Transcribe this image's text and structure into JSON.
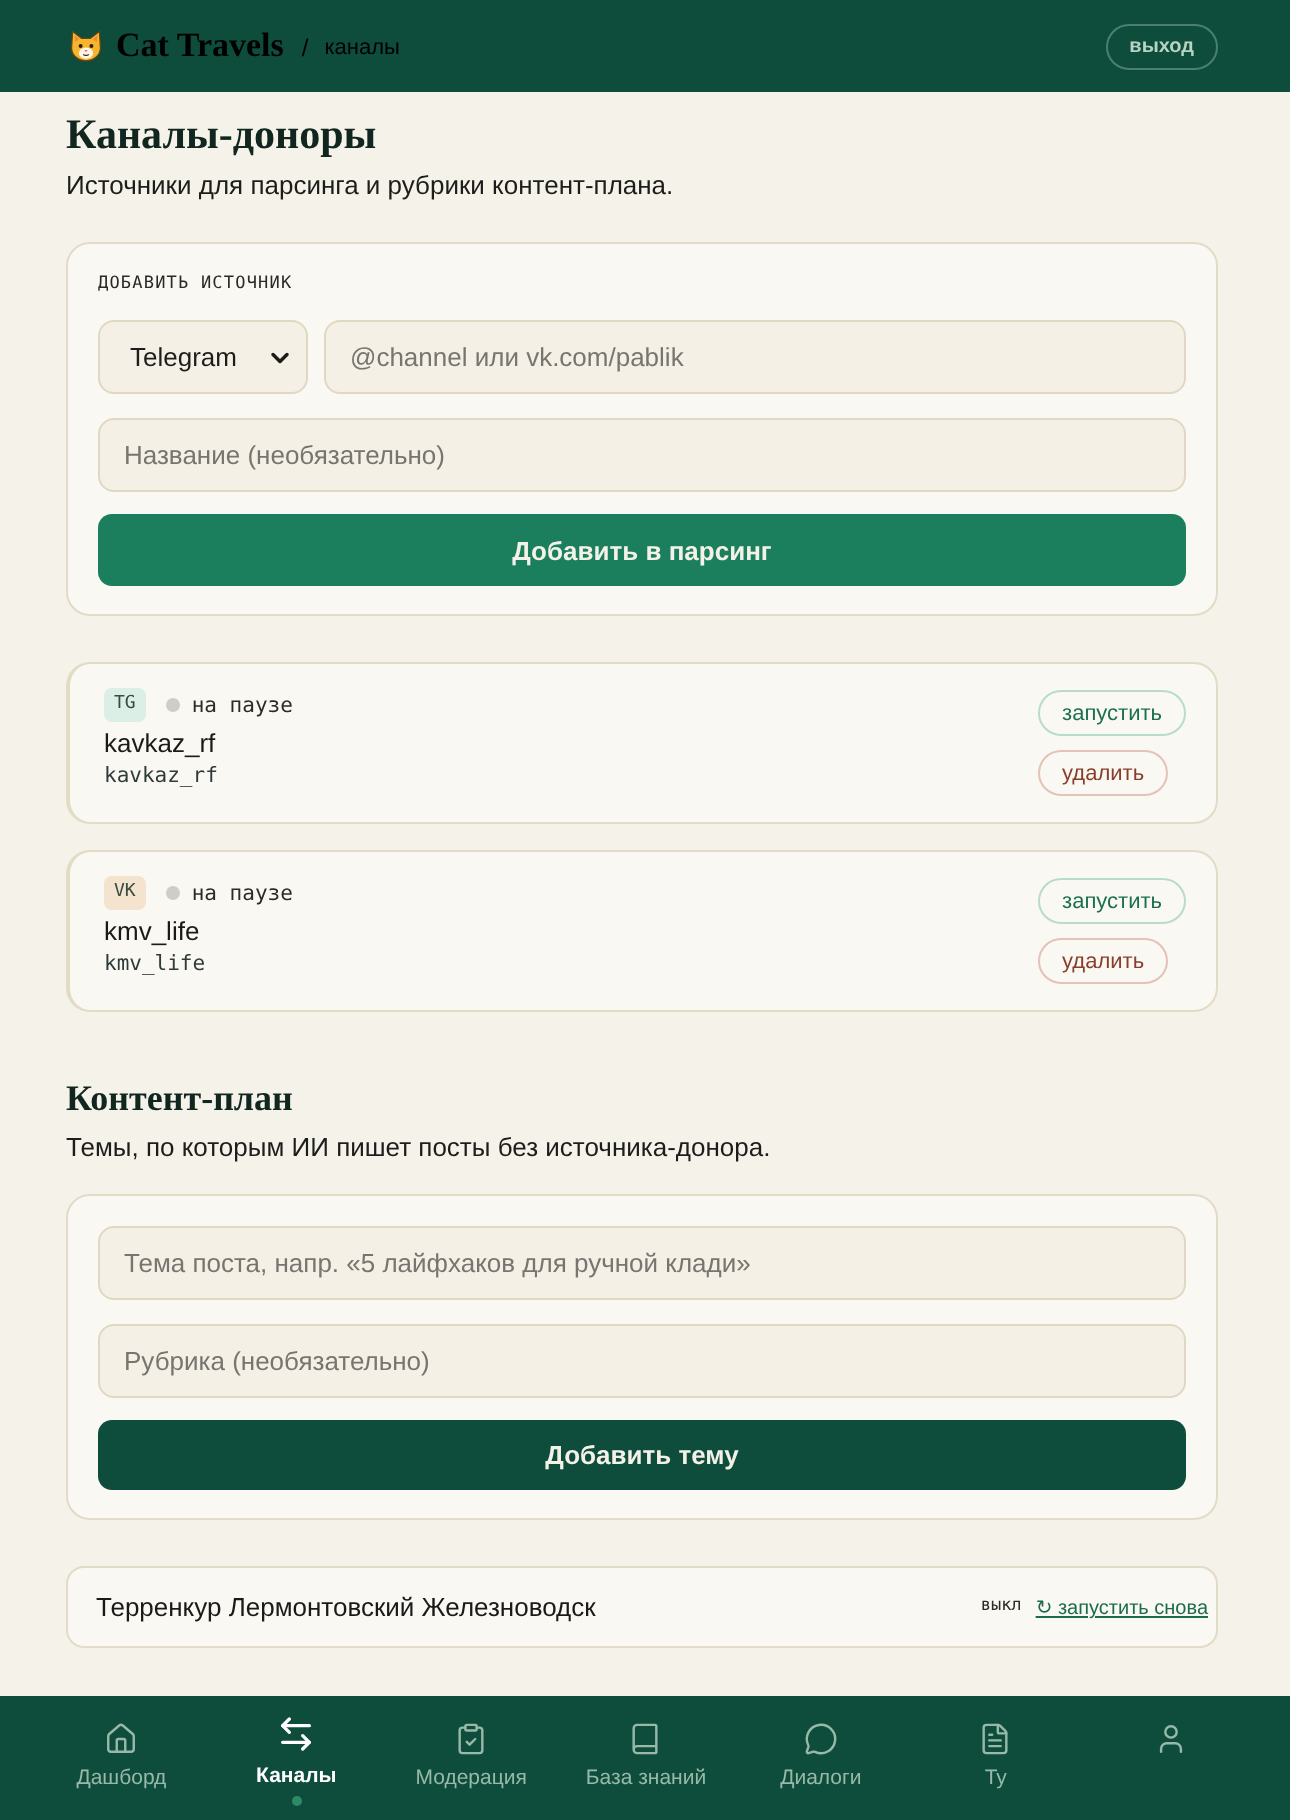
{
  "header": {
    "logo": "Cat Travels",
    "separator": "/",
    "breadcrumb": "каналы",
    "logout": "выход"
  },
  "page": {
    "title": "Каналы-доноры",
    "subtitle": "Источники для парсинга и рубрики контент-плана."
  },
  "add_source": {
    "label": "ДОБАВИТЬ ИСТОЧНИК",
    "platform": "Telegram",
    "link": {
      "placeholder": "@channel или vk.com/pablik"
    },
    "name": {
      "placeholder": "Название (необязательно)"
    },
    "button": "Добавить в парсинг"
  },
  "channels": [
    {
      "badge": {
        "text": "TG",
        "color": "#dcefe6"
      },
      "status": {
        "text": "на паузе",
        "color": "#cfcdc6"
      },
      "name": "kavkaz_rf",
      "handle": "kavkaz_rf",
      "buttons": [
        {
          "label": "запустить",
          "kind": "start"
        },
        {
          "label": "удалить",
          "kind": "delete"
        }
      ]
    },
    {
      "badge": {
        "text": "VK",
        "color": "#f3e3cf"
      },
      "status": {
        "text": "на паузе",
        "color": "#cfcdc6"
      },
      "name": "kmv_life",
      "handle": "kmv_life",
      "buttons": [
        {
          "label": "запустить",
          "kind": "start"
        },
        {
          "label": "удалить",
          "kind": "delete"
        }
      ]
    }
  ],
  "content_plan": {
    "title": "Контент-план",
    "subtitle": "Темы, по которым ИИ пишет посты без источника-донора.",
    "topic": {
      "placeholder": "Тема поста, напр. «5 лайфхаков для ручной клади»"
    },
    "rubric": {
      "placeholder": "Рубрика (необязательно)"
    },
    "button": "Добавить тему"
  },
  "topics": [
    {
      "title": "Терренкур Лермонтовский Железноводск",
      "state": "выкл",
      "action": "↻ запустить снова"
    }
  ],
  "bottom_nav": [
    {
      "label": "Дашборд",
      "selected": false
    },
    {
      "label": "Каналы",
      "selected": true
    },
    {
      "label": "Модерация",
      "selected": false
    },
    {
      "label": "База знаний",
      "selected": false
    },
    {
      "label": "Диалоги",
      "selected": false
    },
    {
      "label": "Ту",
      "selected": false
    },
    {
      "selected": false
    }
  ]
}
